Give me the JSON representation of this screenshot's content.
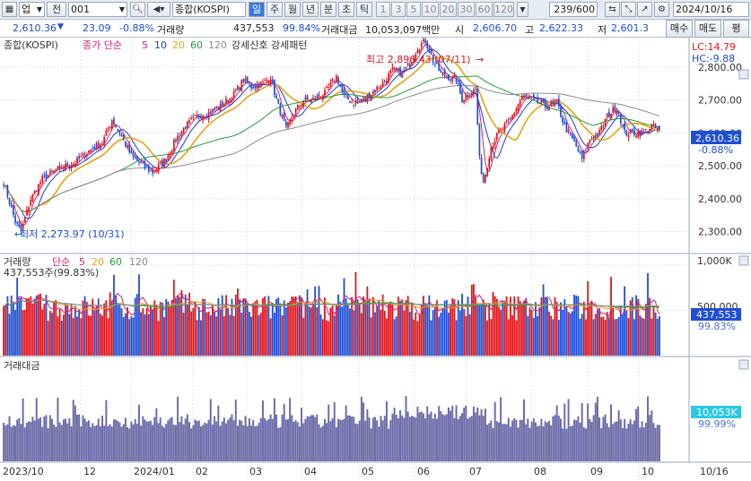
{
  "toolbar": {
    "market_select": "업",
    "jeon_label": "전",
    "code": "001",
    "name": "종합(KOSPI)",
    "periods": [
      "일",
      "주",
      "월",
      "년",
      "분",
      "초",
      "틱"
    ],
    "active_period": "일",
    "minutes": [
      "1",
      "3",
      "5",
      "10",
      "20",
      "30",
      "60",
      "120"
    ],
    "count": "239/600",
    "date": "2024/10/16"
  },
  "info": {
    "price": "2,610.36",
    "change": "23.09",
    "change_pct": "-0.88%",
    "volume_label": "거래량",
    "volume": "437,553",
    "volume_pct": "99.84%",
    "amount_label": "거래대금",
    "amount": "10,053,097백만",
    "open_label": "시",
    "open": "2,606.70",
    "high_label": "고",
    "high": "2,622.33",
    "low_label": "저",
    "low": "2,601.3",
    "buy_label": "매수",
    "sell_label": "매도",
    "eval_label": "평"
  },
  "price_panel": {
    "title": "종합(KOSPI)",
    "ma_label": "종가 단순",
    "ma_periods": [
      "5",
      "10",
      "20",
      "60",
      "120"
    ],
    "ma_colors": [
      "#d6227a",
      "#1e3fc8",
      "#e8a21a",
      "#2a9a3a",
      "#8c8c8c"
    ],
    "pattern_label": "강세신호 강세패턴",
    "high_annotation": "최고 2,896.43 (07/11)",
    "low_annotation": "최저 2,273.97 (10/31)",
    "lc_label": "LC:14.79",
    "hc_label": "HC:-9.88",
    "last_price": "2,610.36",
    "last_pct": "-0.88%",
    "yticks": [
      "2,800.00",
      "2,700.00",
      "2,600.00",
      "2,500.00",
      "2,400.00",
      "2,300.00"
    ]
  },
  "volume_panel": {
    "title": "거래량",
    "ma_label": "단순",
    "ma_periods": [
      "5",
      "20",
      "60",
      "120"
    ],
    "ma_colors": [
      "#d6227a",
      "#e8a21a",
      "#2a9a3a",
      "#8c8c8c"
    ],
    "current": "437,553주(99.83%)",
    "yticks": [
      "1,000K",
      "500,000"
    ],
    "last_value": "437,553",
    "last_pct": "99.83%"
  },
  "amount_panel": {
    "title": "거래대금",
    "last_value": "10,053K",
    "last_pct": "99.99%"
  },
  "xaxis": {
    "labels": [
      "2023/10",
      "12",
      "2024/01",
      "02",
      "03",
      "04",
      "05",
      "06",
      "07",
      "08",
      "09",
      "10"
    ],
    "right_label": "10/16"
  },
  "chart_data": {
    "type": "candlestick",
    "x_range": [
      "2023/10",
      "2024/10/16"
    ],
    "ylim": [
      2250,
      2900
    ],
    "close_anchors": [
      [
        0,
        2450
      ],
      [
        6,
        2330
      ],
      [
        9,
        2300
      ],
      [
        14,
        2400
      ],
      [
        20,
        2460
      ],
      [
        28,
        2490
      ],
      [
        37,
        2510
      ],
      [
        45,
        2550
      ],
      [
        51,
        2570
      ],
      [
        56,
        2640
      ],
      [
        60,
        2600
      ],
      [
        66,
        2530
      ],
      [
        72,
        2500
      ],
      [
        77,
        2480
      ],
      [
        84,
        2520
      ],
      [
        89,
        2580
      ],
      [
        94,
        2620
      ],
      [
        100,
        2650
      ],
      [
        106,
        2660
      ],
      [
        112,
        2680
      ],
      [
        118,
        2710
      ],
      [
        124,
        2760
      ],
      [
        128,
        2740
      ],
      [
        134,
        2750
      ],
      [
        138,
        2770
      ],
      [
        141,
        2700
      ],
      [
        146,
        2610
      ],
      [
        150,
        2660
      ],
      [
        155,
        2700
      ],
      [
        160,
        2700
      ],
      [
        166,
        2720
      ],
      [
        172,
        2770
      ],
      [
        176,
        2710
      ],
      [
        181,
        2690
      ],
      [
        186,
        2700
      ],
      [
        190,
        2720
      ],
      [
        196,
        2750
      ],
      [
        201,
        2790
      ],
      [
        206,
        2780
      ],
      [
        210,
        2810
      ],
      [
        214,
        2860
      ],
      [
        218,
        2880
      ],
      [
        222,
        2820
      ],
      [
        226,
        2780
      ],
      [
        230,
        2770
      ],
      [
        234,
        2760
      ],
      [
        237,
        2700
      ],
      [
        240,
        2720
      ],
      [
        244,
        2730
      ],
      [
        246,
        2520
      ],
      [
        248,
        2450
      ],
      [
        252,
        2560
      ],
      [
        256,
        2600
      ],
      [
        262,
        2640
      ],
      [
        268,
        2710
      ],
      [
        274,
        2700
      ],
      [
        280,
        2680
      ],
      [
        286,
        2690
      ],
      [
        290,
        2620
      ],
      [
        295,
        2570
      ],
      [
        299,
        2520
      ],
      [
        303,
        2580
      ],
      [
        308,
        2600
      ],
      [
        312,
        2650
      ],
      [
        317,
        2680
      ],
      [
        321,
        2600
      ],
      [
        326,
        2600
      ],
      [
        331,
        2600
      ],
      [
        335,
        2620
      ],
      [
        339,
        2610
      ]
    ],
    "volume_ylim": [
      0,
      1100000
    ],
    "amount_ylim": [
      0,
      25000000
    ]
  }
}
